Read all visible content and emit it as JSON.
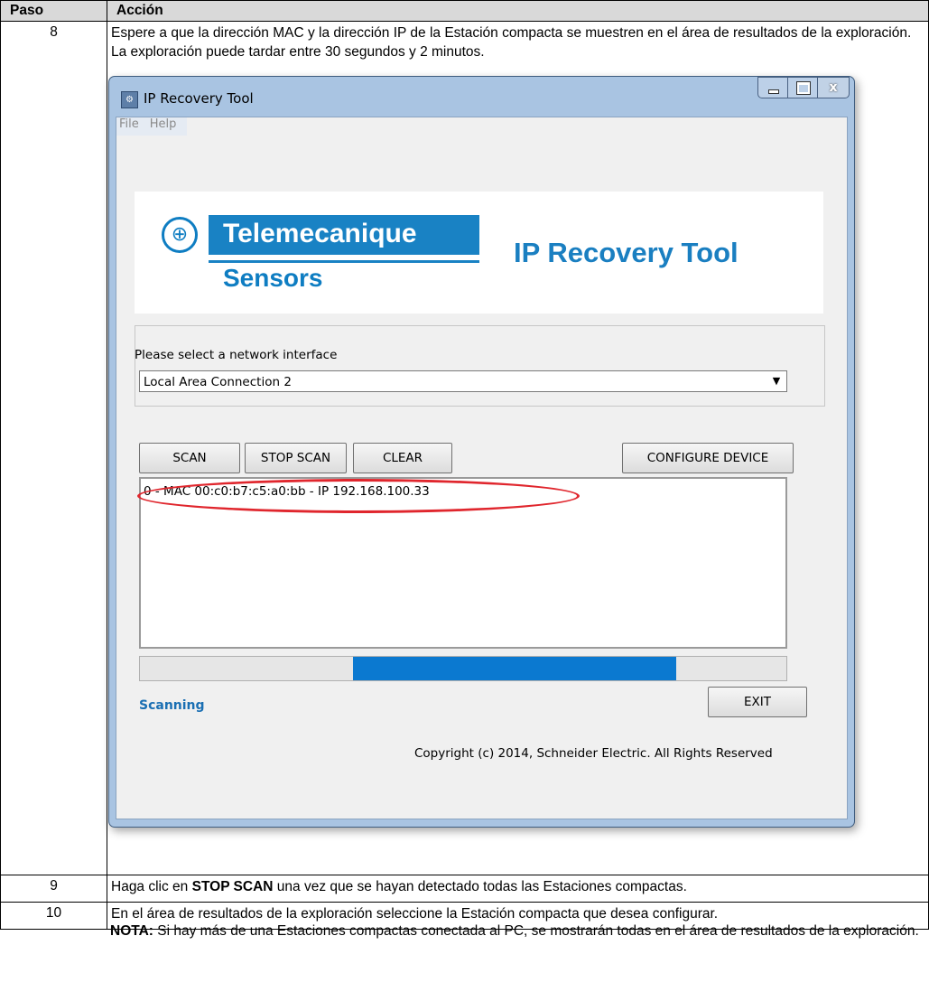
{
  "table": {
    "header": {
      "col_step": "Paso",
      "col_action": "Acción"
    },
    "rows": [
      {
        "step": "8",
        "intro": "Espere a que la dirección MAC y la dirección IP de la Estación compacta se muestren en el área de resultados de la exploración. La exploración puede tardar entre 30 segundos y 2 minutos.",
        "note_keyword": "NOTA:",
        "note_text": " Si hay más de una Estaciones compactas conectada al PC, se mostrarán todas en el área de resultados de la exploración."
      },
      {
        "step": "9",
        "text_before": "Haga clic en ",
        "text_bold": "STOP SCAN",
        "text_after": " una vez que se hayan detectado todas las Estaciones compactas."
      },
      {
        "step": "10",
        "text": "En el área de resultados de la exploración seleccione la Estación compacta que desea configurar."
      }
    ]
  },
  "window": {
    "title": "IP Recovery Tool",
    "app_icon": "tool-icon",
    "controls": {
      "close": "x"
    },
    "menu": [
      "File",
      "Help"
    ],
    "brand": {
      "logo_word": "Telemecanique",
      "logo_sub": "Sensors",
      "product": "IP Recovery Tool"
    },
    "interface_label": "Please select a network interface",
    "interface_value": "Local Area Connection 2",
    "buttons": {
      "scan": "SCAN",
      "stop": "STOP SCAN",
      "clear": "CLEAR",
      "configure": "CONFIGURE DEVICE",
      "exit": "EXIT"
    },
    "results": [
      "0 - MAC 00:c0:b7:c5:a0:bb - IP 192.168.100.33"
    ],
    "progress": {
      "start": 0.33,
      "end": 0.83
    },
    "status": "Scanning",
    "copyright": "Copyright (c) 2014, Schneider Electric. All Rights Reserved"
  },
  "colors": {
    "accent": "#0b79d0",
    "highlight": "#e0262d",
    "brand": "#1982c4"
  }
}
